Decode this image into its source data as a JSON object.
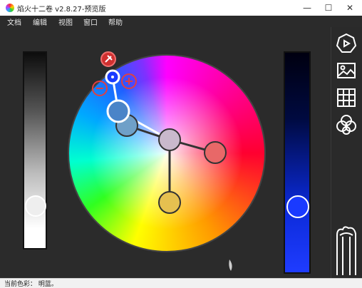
{
  "window": {
    "title": "焰火十二卷 v2.8.27-预览版",
    "controls": {
      "minimize": "—",
      "maximize": "☐",
      "close": "✕"
    }
  },
  "menu": {
    "items": [
      {
        "label": "文档"
      },
      {
        "label": "编辑"
      },
      {
        "label": "视图"
      },
      {
        "label": "窗口"
      },
      {
        "label": "帮助"
      }
    ]
  },
  "status": {
    "text": "当前色彩： 明蓝。"
  },
  "colors": {
    "handle_main": "#4a84c8",
    "handle_cyan_blue": "#6fa0c8",
    "handle_center": "#c9b9cc",
    "handle_red": "#e86868",
    "handle_yellow": "#e6c050",
    "pin_red": "#d03030",
    "blue_knob": "#1a3aff"
  },
  "toolbar": {
    "tools": [
      {
        "icon": "heptagon-icon"
      },
      {
        "icon": "image-icon"
      },
      {
        "icon": "grid-icon"
      },
      {
        "icon": "circles-icon"
      },
      {
        "icon": "cylinder-icon"
      }
    ]
  }
}
